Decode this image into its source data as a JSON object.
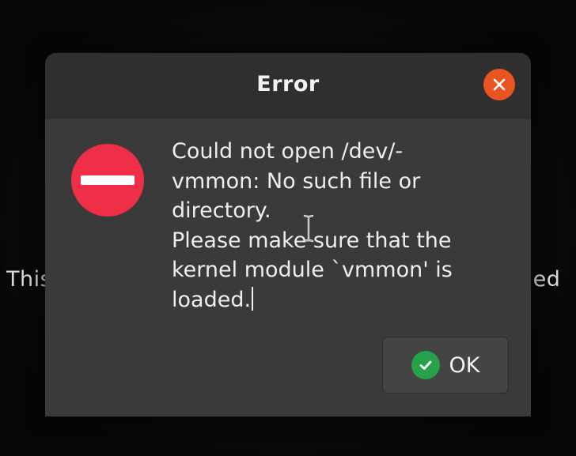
{
  "background": {
    "text_left": "This",
    "text_right": "ded"
  },
  "dialog": {
    "title": "Error",
    "message": "Could not open /dev/-\nvmmon: No such file or\ndirectory.\nPlease make sure that the\nkernel module `vmmon' is\nloaded.",
    "ok_label": "OK"
  },
  "icons": {
    "close": "close-icon",
    "error": "error-stop-icon",
    "ok": "checkmark-icon",
    "cursor": "text-cursor-icon"
  },
  "colors": {
    "close_button": "#e95420",
    "error_icon": "#ef2e48",
    "ok_icon": "#26a24a",
    "dialog_bg": "#3a3a3a",
    "titlebar_bg": "#2f2f2f"
  }
}
